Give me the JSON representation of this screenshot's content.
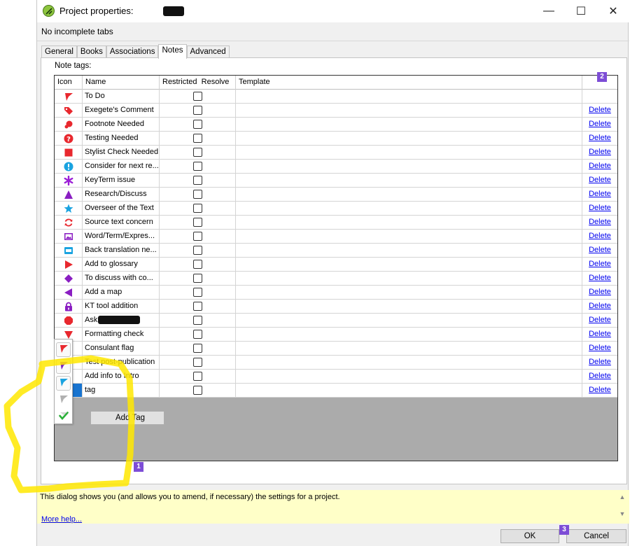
{
  "window": {
    "title": "Project properties:",
    "minimize": "—",
    "maximize": "☐",
    "close": "✕"
  },
  "status": "No incomplete tabs",
  "tabs": [
    "General",
    "Books",
    "Associations",
    "Notes",
    "Advanced"
  ],
  "active_tab": "Notes",
  "note_tags_label": "Note tags:",
  "table": {
    "columns": [
      "Icon",
      "Name",
      "Restricted",
      "Resolve",
      "Template"
    ],
    "rows": [
      {
        "icon": "flag",
        "color": "#e8282e",
        "name": "To Do",
        "delete": ""
      },
      {
        "icon": "tag",
        "color": "#e8282e",
        "name": "Exegete's Comment",
        "delete": "Delete"
      },
      {
        "icon": "blob",
        "color": "#e8282e",
        "name": "Footnote Needed",
        "delete": "Delete"
      },
      {
        "icon": "question",
        "color": "#e8282e",
        "name": "Testing Needed",
        "delete": "Delete"
      },
      {
        "icon": "square",
        "color": "#e8282e",
        "name": "Stylist Check Needed",
        "delete": "Delete"
      },
      {
        "icon": "exclaim",
        "color": "#1aa3e0",
        "name": "Consider for next re...",
        "delete": "Delete"
      },
      {
        "icon": "asterisk",
        "color": "#9b1ed6",
        "name": "KeyTerm issue",
        "delete": "Delete"
      },
      {
        "icon": "triangle",
        "color": "#8a1ec2",
        "name": "Research/Discuss",
        "delete": "Delete"
      },
      {
        "icon": "star",
        "color": "#1aa3e0",
        "name": "Overseer of the Text",
        "delete": "Delete"
      },
      {
        "icon": "circle-arrows",
        "color": "#e8282e",
        "name": "Source text concern",
        "delete": "Delete"
      },
      {
        "icon": "image",
        "color": "#8a1ec2",
        "name": "Word/Term/Expres...",
        "delete": "Delete"
      },
      {
        "icon": "screen",
        "color": "#1aa3e0",
        "name": "Back translation ne...",
        "delete": "Delete"
      },
      {
        "icon": "triangle-right",
        "color": "#e8282e",
        "name": "Add to glossary",
        "delete": "Delete"
      },
      {
        "icon": "diamond",
        "color": "#8a1ec2",
        "name": "To discuss with co...",
        "delete": "Delete"
      },
      {
        "icon": "triangle-left",
        "color": "#8a1ec2",
        "name": "Add a map",
        "delete": "Delete"
      },
      {
        "icon": "lock",
        "color": "#8a1ec2",
        "name": "KT tool addition",
        "delete": "Delete"
      },
      {
        "icon": "octagon",
        "color": "#e8282e",
        "name": "Ask",
        "delete": "Delete",
        "redacted": true
      },
      {
        "icon": "triangle-down",
        "color": "#e8282e",
        "name": "Formatting check",
        "delete": "Delete"
      },
      {
        "icon": "flag",
        "color": "#6a1ec2",
        "name": "Consulant flag",
        "delete": "Delete"
      },
      {
        "icon": "flag",
        "color": "#2cc23a",
        "name": "Test post-publication",
        "delete": "Delete"
      },
      {
        "icon": "flag",
        "color": "#1ec2b0",
        "name": "Add info to Intro",
        "delete": "Delete"
      },
      {
        "icon": "flag-selected",
        "color": "#e8282e",
        "name": "tag",
        "delete": "Delete",
        "selected": true
      }
    ]
  },
  "dropdown_icons": [
    {
      "icon": "flag",
      "color": "#e8282e"
    },
    {
      "icon": "flag",
      "color": "#7a1ec2"
    },
    {
      "icon": "flag",
      "color": "#1aa3e0"
    },
    {
      "icon": "flag",
      "color": "#b0b0b0"
    },
    {
      "icon": "check",
      "color": "#2cb03a"
    }
  ],
  "add_tag_label": "Add Tag",
  "badges": [
    "1",
    "2",
    "3"
  ],
  "help": {
    "text": "This dialog shows you (and allows you to amend, if necessary) the settings for a project.",
    "more_help": "More help..."
  },
  "buttons": {
    "ok": "OK",
    "cancel": "Cancel"
  },
  "colors": {
    "highlight": "#ffe800",
    "badge": "#7d4dd6",
    "selection": "#1874d0",
    "help_bg": "#ffffc8"
  }
}
